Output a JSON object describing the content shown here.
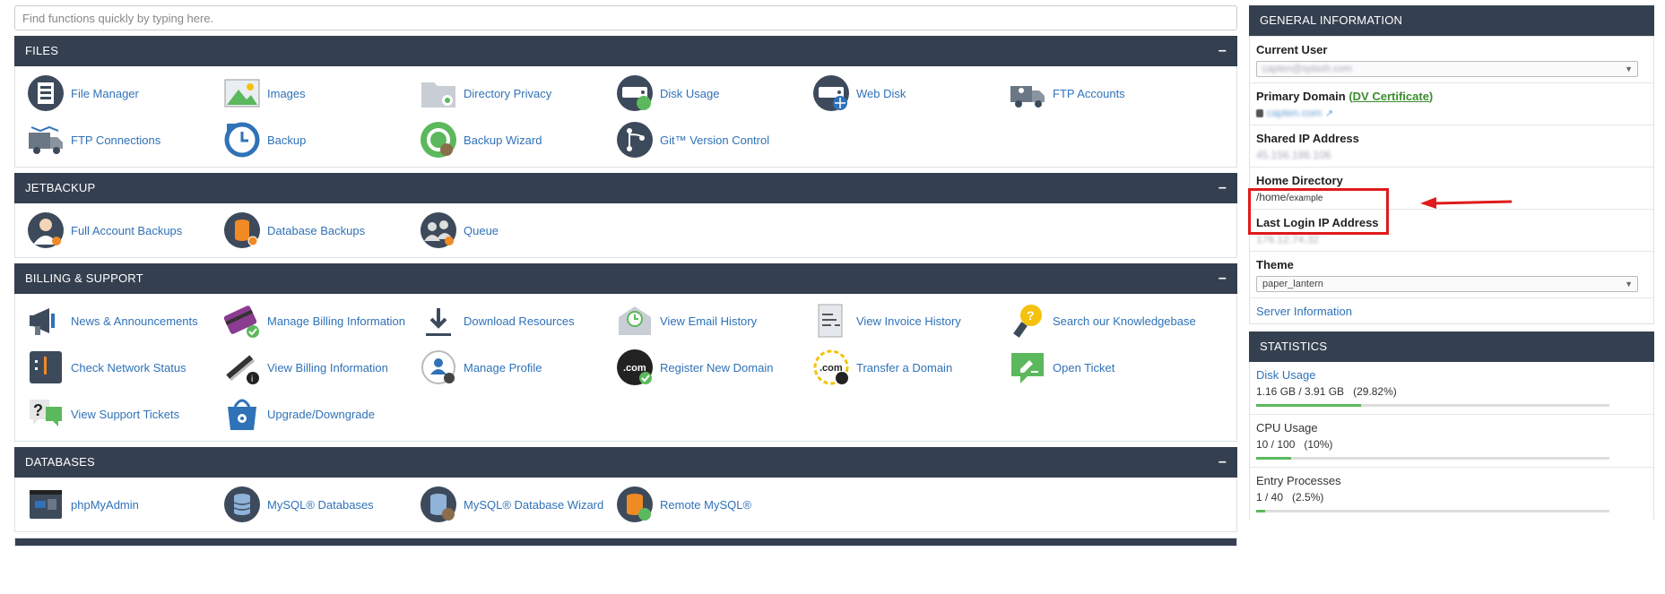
{
  "search": {
    "placeholder": "Find functions quickly by typing here."
  },
  "sections": {
    "files": {
      "title": "FILES",
      "items": [
        "File Manager",
        "Images",
        "Directory Privacy",
        "Disk Usage",
        "Web Disk",
        "FTP Accounts",
        "FTP Connections",
        "Backup",
        "Backup Wizard",
        "Git™ Version Control"
      ]
    },
    "jetbackup": {
      "title": "JETBACKUP",
      "items": [
        "Full Account Backups",
        "Database Backups",
        "Queue"
      ]
    },
    "billing": {
      "title": "BILLING & SUPPORT",
      "items": [
        "News & Announcements",
        "Manage Billing Information",
        "Download Resources",
        "View Email History",
        "View Invoice History",
        "Search our Knowledgebase",
        "Check Network Status",
        "View Billing Information",
        "Manage Profile",
        "Register New Domain",
        "Transfer a Domain",
        "Open Ticket",
        "View Support Tickets",
        "Upgrade/Downgrade"
      ]
    },
    "databases": {
      "title": "DATABASES",
      "items": [
        "phpMyAdmin",
        "MySQL® Databases",
        "MySQL® Database Wizard",
        "Remote MySQL®"
      ]
    },
    "collapse_symbol": "–"
  },
  "general": {
    "title": "GENERAL INFORMATION",
    "current_user_label": "Current User",
    "current_user_value": "capten@splash.com",
    "primary_domain_label": "Primary Domain",
    "dv_open": "(",
    "dv_text": "DV Certificate",
    "dv_close": ")",
    "primary_domain_value": "capten.com",
    "shared_ip_label": "Shared IP Address",
    "shared_ip_value": "45.156.186.106",
    "home_dir_label": "Home Directory",
    "home_dir_prefix": "/home/",
    "home_dir_user": "example",
    "last_login_label": "Last Login IP Address",
    "last_login_value": "176.12.74.32",
    "theme_label": "Theme",
    "theme_value": "paper_lantern",
    "server_info": "Server Information"
  },
  "statistics": {
    "title": "STATISTICS",
    "disk_label": "Disk Usage",
    "disk_value": "1.16 GB / 3.91 GB",
    "disk_pct": "(29.82%)",
    "disk_fraction": 0.2982,
    "cpu_label": "CPU Usage",
    "cpu_value": "10 / 100",
    "cpu_pct": "(10%)",
    "cpu_fraction": 0.1,
    "entry_label": "Entry Processes",
    "entry_value": "1 / 40",
    "entry_pct": "(2.5%)",
    "entry_fraction": 0.025
  },
  "colors": {
    "header": "#343f4f",
    "link": "#2f72b8",
    "highlight": "#e01b1b",
    "bar_fill": "#5cb85c"
  },
  "icons": {
    "files": [
      "file-manager-icon",
      "images-icon",
      "directory-privacy-icon",
      "disk-usage-icon",
      "web-disk-icon",
      "ftp-accounts-icon",
      "ftp-connections-icon",
      "backup-icon",
      "backup-wizard-icon",
      "git-version-control-icon"
    ],
    "jetbackup": [
      "full-account-backups-icon",
      "database-backups-icon",
      "queue-icon"
    ],
    "billing": [
      "news-announcements-icon",
      "manage-billing-icon",
      "download-resources-icon",
      "email-history-icon",
      "invoice-history-icon",
      "knowledgebase-icon",
      "network-status-icon",
      "billing-information-icon",
      "manage-profile-icon",
      "register-domain-icon",
      "transfer-domain-icon",
      "open-ticket-icon",
      "support-tickets-icon",
      "upgrade-downgrade-icon"
    ],
    "databases": [
      "phpmyadmin-icon",
      "mysql-databases-icon",
      "mysql-wizard-icon",
      "remote-mysql-icon"
    ]
  }
}
